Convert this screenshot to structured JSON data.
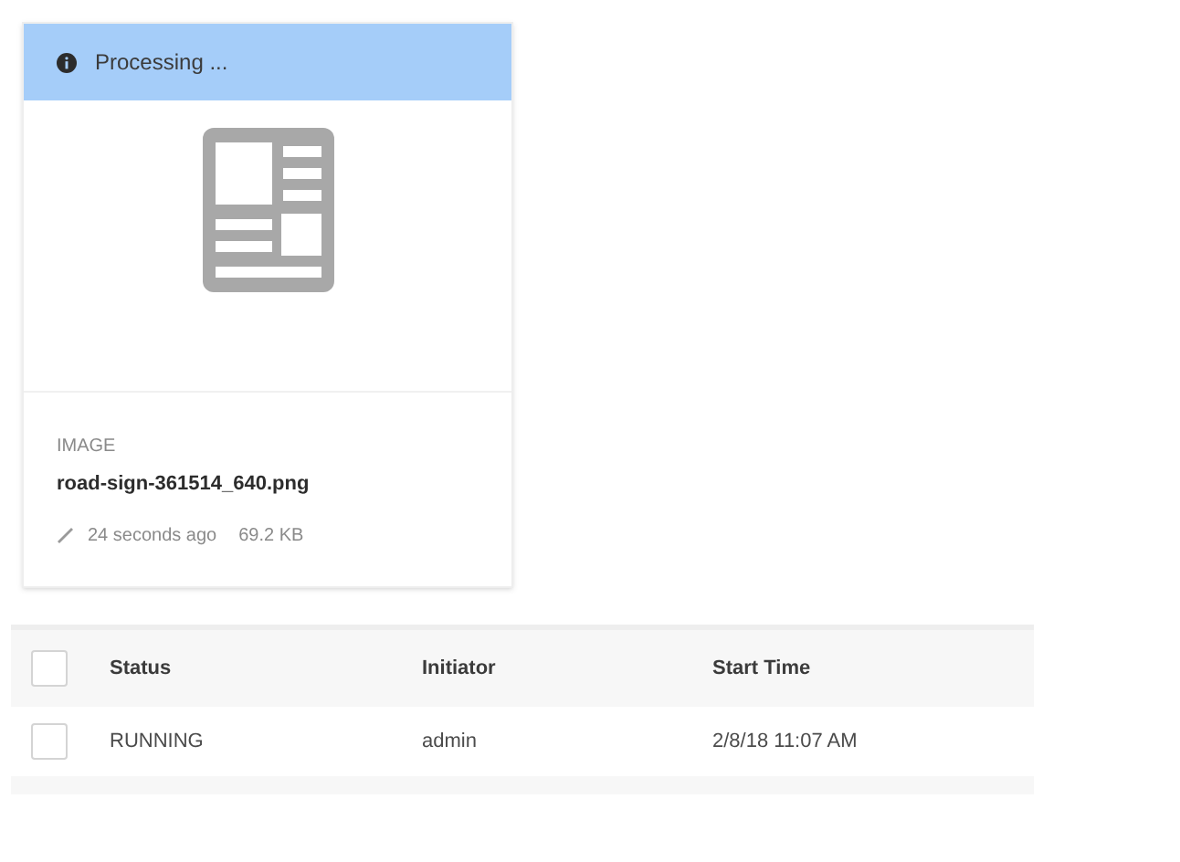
{
  "card": {
    "banner": "Processing ...",
    "type": "IMAGE",
    "filename": "road-sign-361514_640.png",
    "modified": "24 seconds ago",
    "size": "69.2 KB"
  },
  "table": {
    "header_checked": false,
    "columns": [
      "Status",
      "Initiator",
      "Start Time"
    ],
    "rows": [
      {
        "checked": false,
        "cells": [
          "RUNNING",
          "admin",
          "2/8/18 11:07 AM"
        ]
      }
    ]
  }
}
